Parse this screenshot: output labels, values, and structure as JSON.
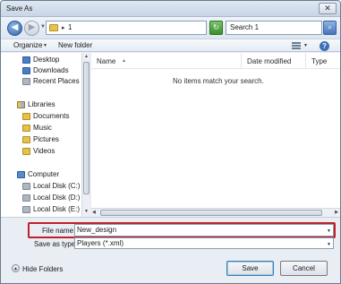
{
  "window": {
    "title": "Save As",
    "close_glyph": "✕"
  },
  "address": {
    "path_separator": "▸",
    "path": "1",
    "search_placeholder": "Search 1"
  },
  "toolbar": {
    "organize_label": "Organize",
    "new_folder_label": "New folder"
  },
  "sidebar": {
    "items": [
      {
        "label": "Desktop",
        "icon": "desktop-icon",
        "kind": "item"
      },
      {
        "label": "Downloads",
        "icon": "downloads-icon",
        "kind": "item"
      },
      {
        "label": "Recent Places",
        "icon": "recent-places-icon",
        "kind": "item"
      },
      {
        "label": "Libraries",
        "icon": "libraries-icon",
        "kind": "group"
      },
      {
        "label": "Documents",
        "icon": "documents-icon",
        "kind": "item"
      },
      {
        "label": "Music",
        "icon": "music-icon",
        "kind": "item"
      },
      {
        "label": "Pictures",
        "icon": "pictures-icon",
        "kind": "item"
      },
      {
        "label": "Videos",
        "icon": "videos-icon",
        "kind": "item"
      },
      {
        "label": "Computer",
        "icon": "computer-icon",
        "kind": "group"
      },
      {
        "label": "Local Disk (C:)",
        "icon": "drive-icon",
        "kind": "item"
      },
      {
        "label": "Local Disk (D:)",
        "icon": "drive-icon",
        "kind": "item"
      },
      {
        "label": "Local Disk (E:)",
        "icon": "drive-icon",
        "kind": "item"
      }
    ]
  },
  "filelist": {
    "columns": [
      "Name",
      "Date modified",
      "Type"
    ],
    "empty_message": "No items match your search."
  },
  "form": {
    "file_name_label": "File name:",
    "file_name_value": "New_design",
    "save_as_type_label": "Save as type:",
    "save_as_type_value": "Players (*.xml)"
  },
  "buttons": {
    "hide_folders": "Hide Folders",
    "save": "Save",
    "cancel": "Cancel"
  },
  "colors": {
    "highlight_border": "#c0202a",
    "accent_blue": "#3c6fb6"
  }
}
